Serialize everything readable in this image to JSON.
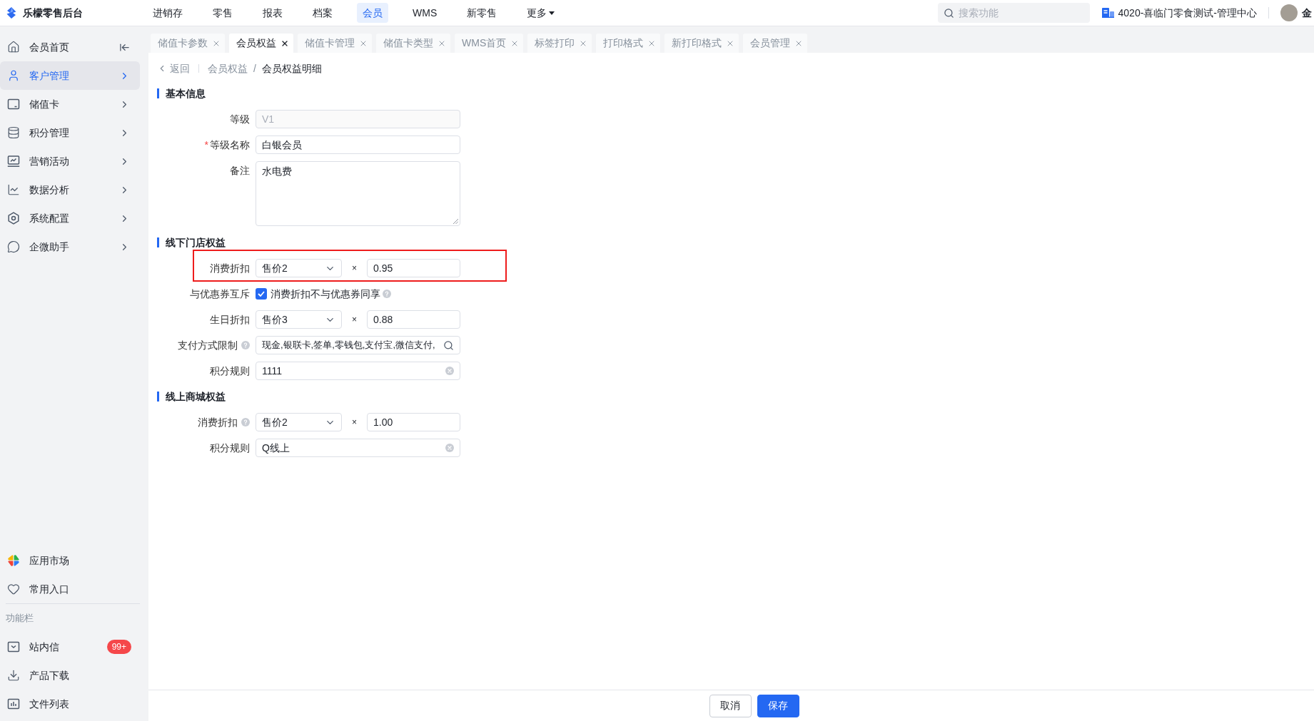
{
  "header": {
    "logo_text": "乐檬零售后台",
    "nav": [
      {
        "label": "进销存",
        "selected": false,
        "dropdown": false
      },
      {
        "label": "零售",
        "selected": false,
        "dropdown": false
      },
      {
        "label": "报表",
        "selected": false,
        "dropdown": false
      },
      {
        "label": "档案",
        "selected": false,
        "dropdown": false
      },
      {
        "label": "会员",
        "selected": true,
        "dropdown": false
      },
      {
        "label": "WMS",
        "selected": false,
        "dropdown": false
      },
      {
        "label": "新零售",
        "selected": false,
        "dropdown": false
      },
      {
        "label": "更多",
        "selected": false,
        "dropdown": true
      }
    ],
    "search": {
      "placeholder": "搜索功能"
    },
    "organization": "4020-喜临门零食测试-管理中心",
    "user_name": "金"
  },
  "sidebar": {
    "items": [
      {
        "label": "会员首页",
        "selected": false,
        "has_submenu": false
      },
      {
        "label": "客户管理",
        "selected": true,
        "has_submenu": true
      },
      {
        "label": "储值卡",
        "selected": false,
        "has_submenu": true
      },
      {
        "label": "积分管理",
        "selected": false,
        "has_submenu": true
      },
      {
        "label": "营销活动",
        "selected": false,
        "has_submenu": true
      },
      {
        "label": "数据分析",
        "selected": false,
        "has_submenu": true
      },
      {
        "label": "系统配置",
        "selected": false,
        "has_submenu": true
      },
      {
        "label": "企微助手",
        "selected": false,
        "has_submenu": true
      }
    ],
    "shortcuts": [
      {
        "label": "应用市场"
      },
      {
        "label": "常用入口"
      }
    ],
    "section_title": "功能栏",
    "tools": [
      {
        "label": "站内信",
        "badge": "99+"
      },
      {
        "label": "产品下载"
      },
      {
        "label": "文件列表"
      }
    ]
  },
  "tabs": [
    {
      "label": "储值卡参数",
      "selected": false
    },
    {
      "label": "会员权益",
      "selected": true
    },
    {
      "label": "储值卡管理",
      "selected": false
    },
    {
      "label": "储值卡类型",
      "selected": false
    },
    {
      "label": "WMS首页",
      "selected": false
    },
    {
      "label": "标签打印",
      "selected": false
    },
    {
      "label": "打印格式",
      "selected": false
    },
    {
      "label": "新打印格式",
      "selected": false
    },
    {
      "label": "会员管理",
      "selected": false
    }
  ],
  "breadcrumb": {
    "back": "返回",
    "separator": "/",
    "items": [
      {
        "label": "会员权益",
        "current": false
      },
      {
        "label": "会员权益明细",
        "current": true
      }
    ]
  },
  "form": {
    "sections": [
      {
        "title": "基本信息",
        "rows": [
          {
            "kind": "text",
            "label": "等级",
            "value": "V1",
            "disabled": true,
            "help": false
          },
          {
            "kind": "text",
            "label": "等级名称",
            "required_mark": "*",
            "value": "白银会员",
            "disabled": false,
            "help": false
          },
          {
            "kind": "textarea",
            "label": "备注",
            "value": "水电费",
            "help": false
          }
        ]
      },
      {
        "title": "线下门店权益",
        "rows": [
          {
            "kind": "discount",
            "label": "消费折扣",
            "select": "售价2",
            "operator": "×",
            "value": "0.95",
            "highlighted": true,
            "help": false
          },
          {
            "kind": "checkbox",
            "label": "与优惠券互斥",
            "checked": true,
            "text": "消费折扣不与优惠券同享",
            "help": true
          },
          {
            "kind": "discount",
            "label": "生日折扣",
            "select": "售价3",
            "operator": "×",
            "value": "0.88",
            "highlighted": false,
            "help": false
          },
          {
            "kind": "search",
            "label": "支付方式限制",
            "value": "现金,银联卡,签单,零钱包,支付宝,微信支付,",
            "help": true
          },
          {
            "kind": "clearable",
            "label": "积分规则",
            "value": "1111",
            "help": false
          }
        ]
      },
      {
        "title": "线上商城权益",
        "rows": [
          {
            "kind": "discount",
            "label": "消费折扣",
            "select": "售价2",
            "operator": "×",
            "value": "1.00",
            "highlighted": false,
            "help": true
          },
          {
            "kind": "clearable",
            "label": "积分规则",
            "value": "Q线上",
            "help": false
          }
        ]
      }
    ]
  },
  "footer": {
    "buttons": [
      {
        "label": "取消",
        "kind": "secondary"
      },
      {
        "label": "保存",
        "kind": "primary"
      }
    ]
  }
}
